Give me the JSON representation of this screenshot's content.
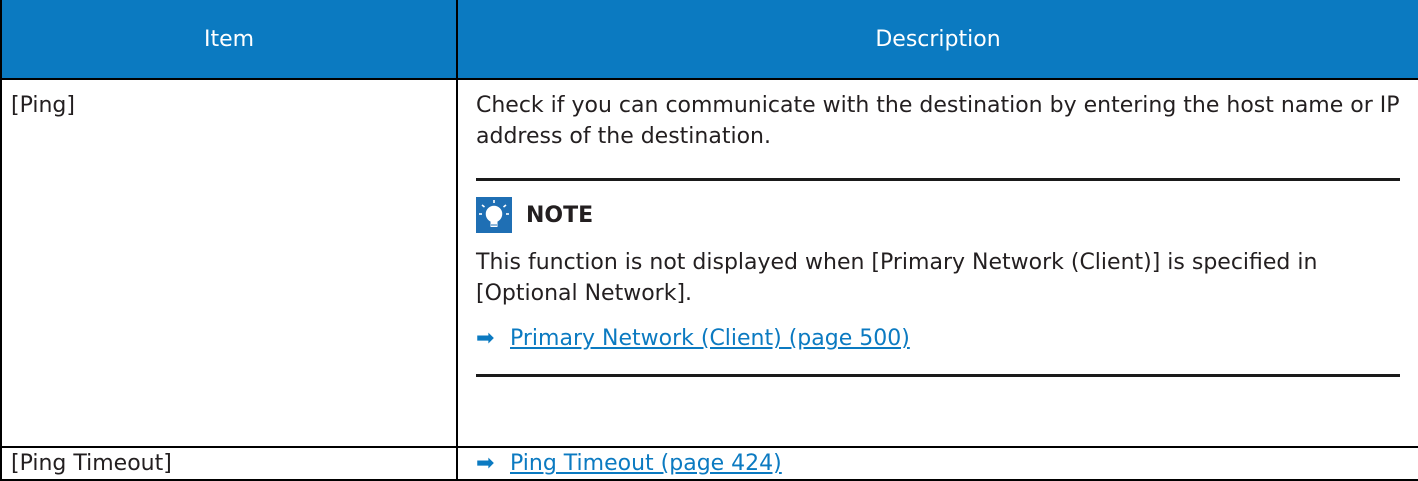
{
  "table": {
    "headers": {
      "item": "Item",
      "description": "Description"
    },
    "rows": [
      {
        "item": "[Ping]",
        "description": "Check if you can communicate with the destination by entering the host name or IP address of the destination.",
        "note": {
          "title": "NOTE",
          "icon": "lightbulb-icon",
          "text": "This function is not displayed when [Primary Network (Client)] is specified in [Optional Network].",
          "link": "Primary Network (Client) (page 500)"
        }
      },
      {
        "item": "[Ping Timeout]",
        "link": "Ping Timeout (page 424)"
      }
    ]
  },
  "colors": {
    "header_bg": "#0b7ac1",
    "link": "#0b7ac1",
    "icon_bg": "#1f6fb4"
  }
}
